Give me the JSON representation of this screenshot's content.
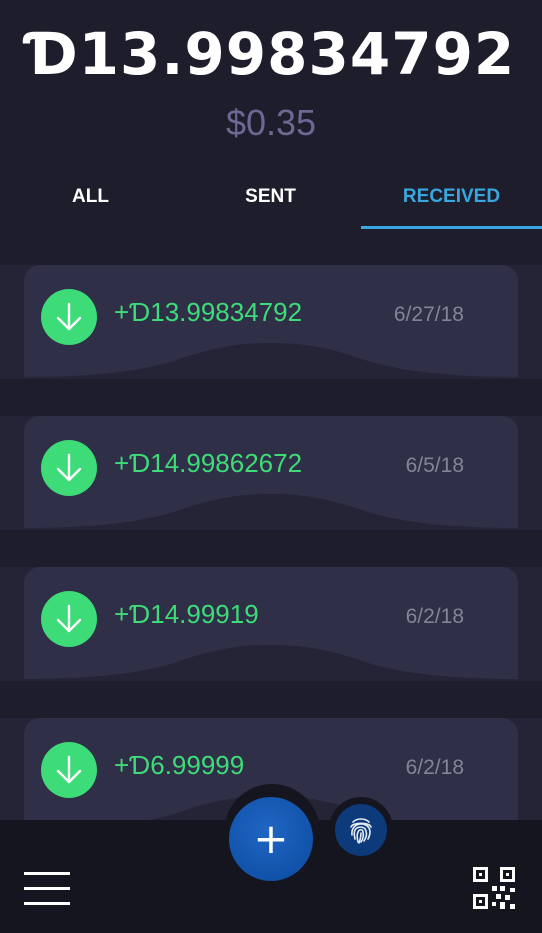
{
  "wallet": {
    "balance": "Ɗ13.99834792",
    "fiat_value": "$0.35"
  },
  "tabs": [
    {
      "label": "ALL",
      "active": false
    },
    {
      "label": "SENT",
      "active": false
    },
    {
      "label": "RECEIVED",
      "active": true
    }
  ],
  "transactions": [
    {
      "amount": "+Ɗ13.99834792",
      "date": "6/27/18",
      "icon": "arrow-down-icon"
    },
    {
      "amount": "+Ɗ14.99862672",
      "date": "6/5/18",
      "icon": "arrow-down-icon"
    },
    {
      "amount": "+Ɗ14.99919",
      "date": "6/2/18",
      "icon": "arrow-down-icon"
    },
    {
      "amount": "+Ɗ6.99999",
      "date": "6/2/18",
      "icon": "arrow-down-icon"
    }
  ],
  "bottom_bar": {
    "fab_icon": "plus-icon",
    "fab_label": "+",
    "fingerprint_icon": "fingerprint-icon",
    "menu_icon": "hamburger-menu-icon",
    "qr_icon": "qr-code-icon"
  },
  "colors": {
    "background": "#1d1d2b",
    "card": "#2f2f47",
    "accent_blue": "#3aa6df",
    "received_green": "#3ddc79",
    "fiat_text": "#6b6994",
    "date_text": "#83839a",
    "fab": "#0b4a9e"
  }
}
